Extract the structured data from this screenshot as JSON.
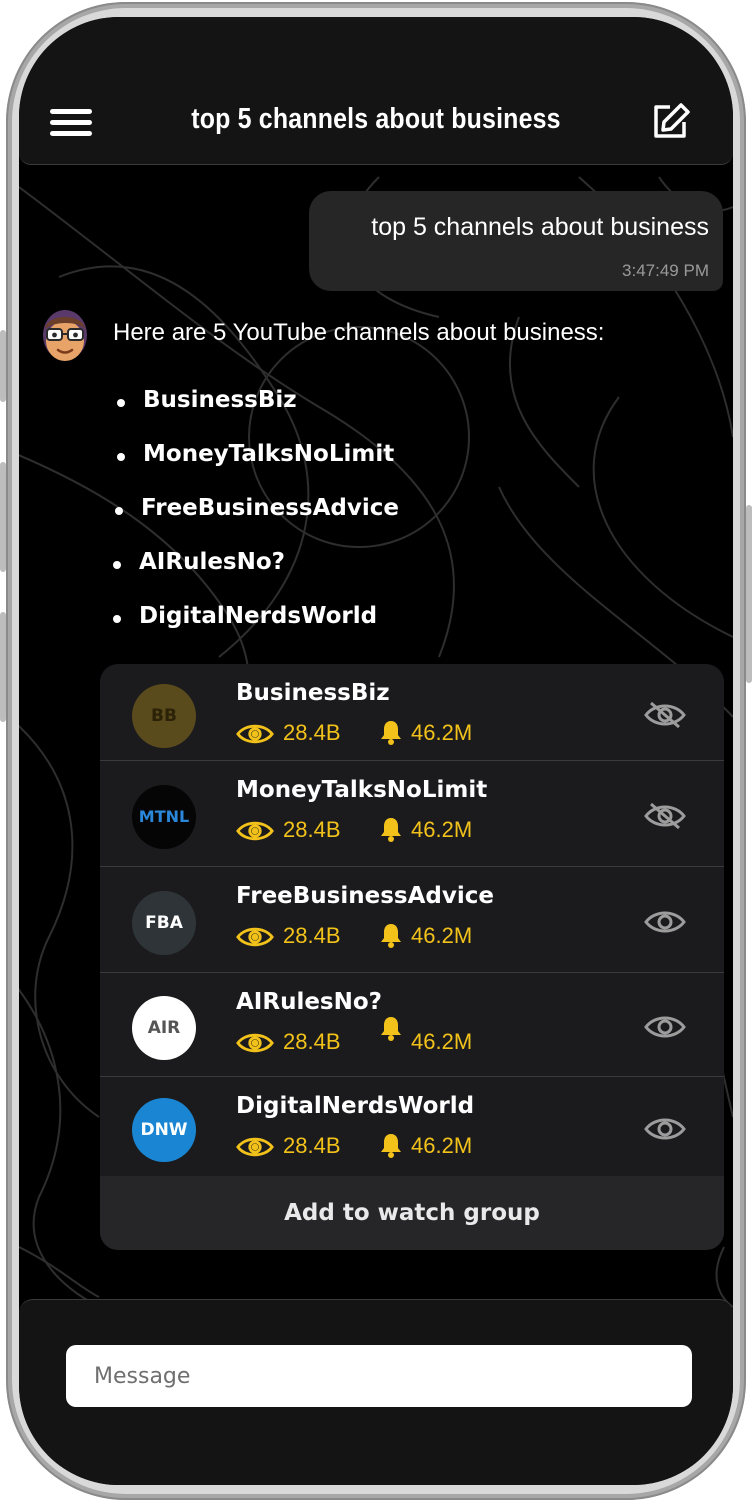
{
  "header": {
    "title": "top 5 channels about business"
  },
  "conversation": {
    "user_message": {
      "text": "top 5 channels about business",
      "time": "3:47:49 PM"
    },
    "bot_intro": "Here are 5 YouTube channels about business:",
    "bullets": [
      "BusinessBiz",
      "MoneyTalksNoLimit",
      "FreeBusinessAdvice",
      "AIRulesNo?",
      "DigitalNerdsWorld"
    ]
  },
  "channels": [
    {
      "initials": "BB",
      "name": "BusinessBiz",
      "views": "28.4B",
      "subscribers": "46.2M",
      "visible": false,
      "avatar_bg": "#5a4b1c",
      "avatar_fg": "#2b2208"
    },
    {
      "initials": "MTNL",
      "name": "MoneyTalksNoLimit",
      "views": "28.4B",
      "subscribers": "46.2M",
      "visible": false,
      "avatar_bg": "#050505",
      "avatar_fg": "#2a86d8"
    },
    {
      "initials": "FBA",
      "name": "FreeBusinessAdvice",
      "views": "28.4B",
      "subscribers": "46.2M",
      "visible": true,
      "avatar_bg": "#2e3438",
      "avatar_fg": "#ffffff"
    },
    {
      "initials": "AIR",
      "name": "AIRulesNo?",
      "views": "28.4B",
      "subscribers": "46.2M",
      "visible": true,
      "avatar_bg": "#ffffff",
      "avatar_fg": "#555555"
    },
    {
      "initials": "DNW",
      "name": "DigitalNerdsWorld",
      "views": "28.4B",
      "subscribers": "46.2M",
      "visible": true,
      "avatar_bg": "#1a86d3",
      "avatar_fg": "#ffffff"
    }
  ],
  "card": {
    "add_button_label": "Add to watch group"
  },
  "footer": {
    "message_placeholder": "Message"
  },
  "icons": {
    "menu": "hamburger-icon",
    "edit": "edit-icon",
    "views": "eye-icon",
    "subscribers": "bell-icon",
    "visible": "eye-icon",
    "hidden": "eye-slash-icon"
  },
  "colors": {
    "accent": "#f2c21b",
    "background": "#000000",
    "surface": "#1b1b1d",
    "bubble": "#262626"
  }
}
